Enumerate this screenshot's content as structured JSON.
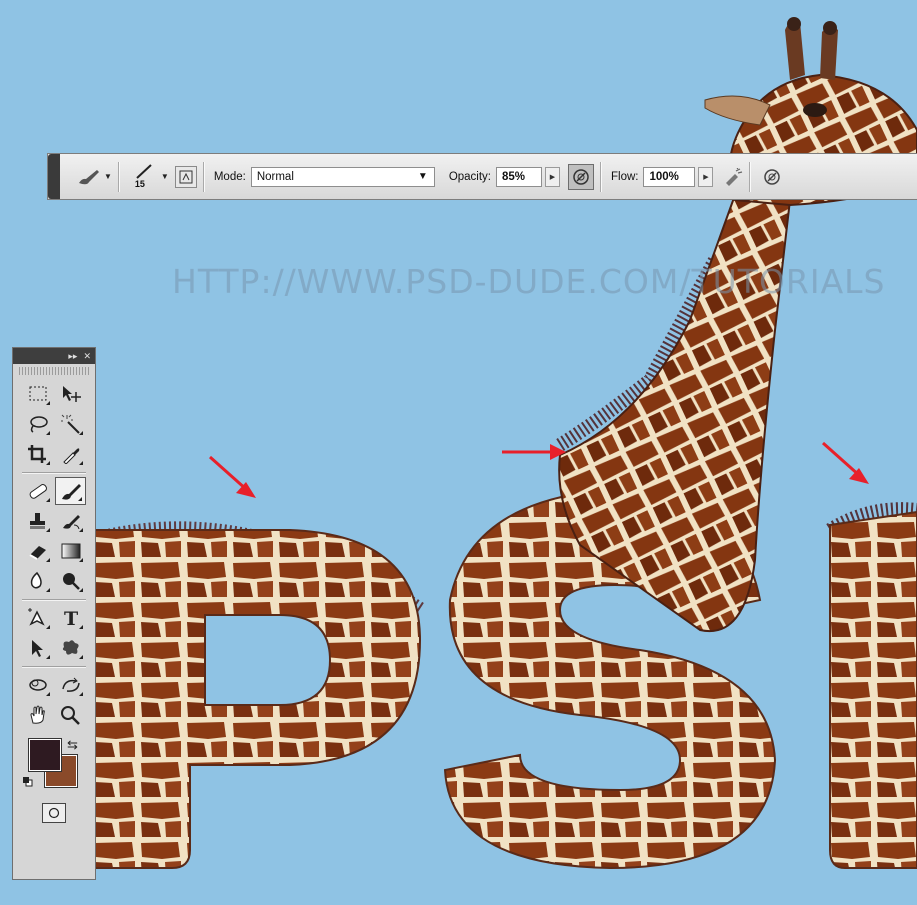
{
  "watermark": "HTTP://WWW.PSD-DUDE.COM/TUTORIALS",
  "options_bar": {
    "brush_size": "15",
    "mode_label": "Mode:",
    "mode_value": "Normal",
    "opacity_label": "Opacity:",
    "opacity_value": "85%",
    "flow_label": "Flow:",
    "flow_value": "100%"
  },
  "tools_panel": {
    "tools": [
      {
        "name": "rectangular-marquee-tool",
        "icon": "marquee-icon"
      },
      {
        "name": "move-tool",
        "icon": "move-icon"
      },
      {
        "name": "lasso-tool",
        "icon": "lasso-icon"
      },
      {
        "name": "magic-wand-tool",
        "icon": "magic-wand-icon"
      },
      {
        "name": "crop-tool",
        "icon": "crop-icon"
      },
      {
        "name": "eyedropper-tool",
        "icon": "eyedropper-icon"
      },
      {
        "name": "healing-brush-tool",
        "icon": "bandage-icon"
      },
      {
        "name": "brush-tool",
        "icon": "brush-icon",
        "active": true
      },
      {
        "name": "clone-stamp-tool",
        "icon": "stamp-icon"
      },
      {
        "name": "history-brush-tool",
        "icon": "history-brush-icon"
      },
      {
        "name": "eraser-tool",
        "icon": "eraser-icon"
      },
      {
        "name": "gradient-tool",
        "icon": "gradient-icon"
      },
      {
        "name": "blur-tool",
        "icon": "blur-icon"
      },
      {
        "name": "dodge-tool",
        "icon": "dodge-icon"
      },
      {
        "name": "pen-tool",
        "icon": "pen-icon"
      },
      {
        "name": "type-tool",
        "icon": "type-icon"
      },
      {
        "name": "path-selection-tool",
        "icon": "arrow-icon"
      },
      {
        "name": "custom-shape-tool",
        "icon": "shape-icon"
      },
      {
        "name": "3d-rotate-tool",
        "icon": "rotate-3d-icon"
      },
      {
        "name": "3d-orbit-tool",
        "icon": "orbit-3d-icon"
      },
      {
        "name": "hand-tool",
        "icon": "hand-icon"
      },
      {
        "name": "zoom-tool",
        "icon": "zoom-icon"
      }
    ],
    "foreground_color": "#2e1a21",
    "background_color": "#8a4a2a"
  },
  "colors": {
    "canvas_background": "#8fc3e4",
    "arrow_color": "#e8202a",
    "giraffe_fur": "#8b3a14",
    "giraffe_lines": "#f1e2c4"
  }
}
